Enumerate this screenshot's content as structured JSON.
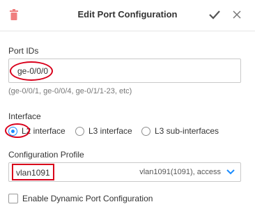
{
  "header": {
    "title": "Edit Port Configuration",
    "icons": {
      "delete": "trash-icon",
      "save": "check-icon",
      "close": "close-icon"
    },
    "colors": {
      "trash": "#f07f7f"
    }
  },
  "port_ids": {
    "label": "Port IDs",
    "value": "ge-0/0/0",
    "hint": "(ge-0/0/1, ge-0/0/4, ge-0/1/1-23, etc)"
  },
  "interface": {
    "label": "Interface",
    "options": [
      {
        "label": "L2 interface",
        "selected": true
      },
      {
        "label": "L3 interface",
        "selected": false
      },
      {
        "label": "L3 sub-interfaces",
        "selected": false
      }
    ],
    "accent": "#1a8cff"
  },
  "config_profile": {
    "label": "Configuration Profile",
    "value": "vlan1091",
    "detail": "vlan1091(1091), access",
    "icon": "chevron-down-icon"
  },
  "dynamic": {
    "label": "Enable Dynamic Port Configuration",
    "checked": false
  },
  "annotation_color": "#d9001b"
}
